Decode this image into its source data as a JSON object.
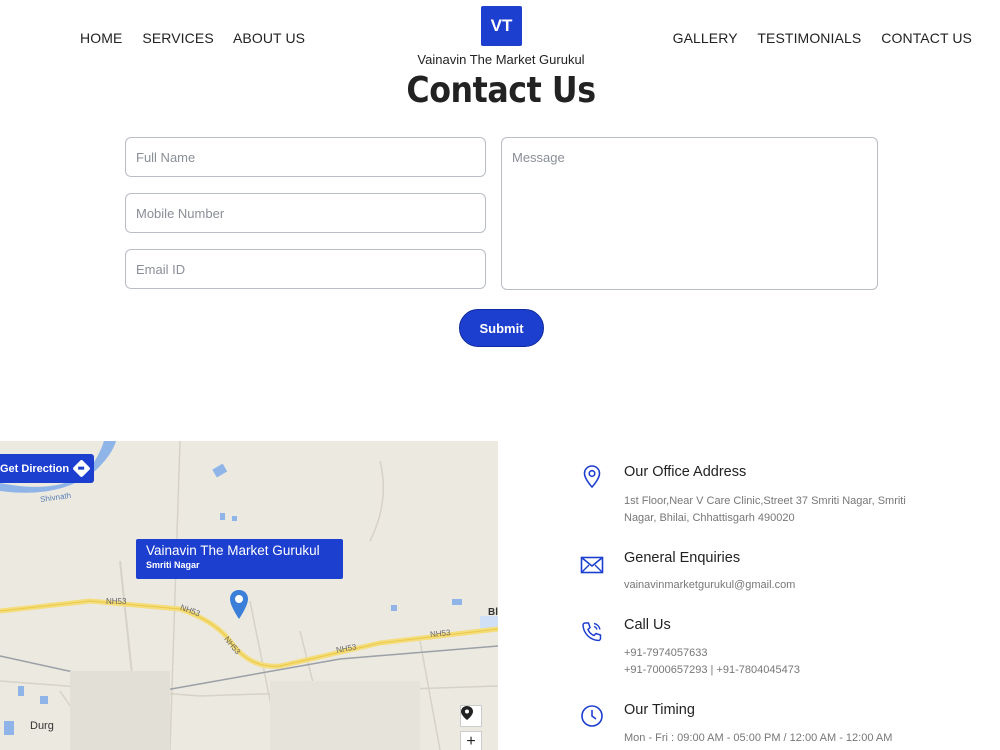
{
  "nav": {
    "left": [
      "HOME",
      "SERVICES",
      "ABOUT US"
    ],
    "right": [
      "GALLERY",
      "TESTIMONIALS",
      "CONTACT US"
    ]
  },
  "brand": {
    "logo": "VT",
    "name": "Vainavin The Market Gurukul"
  },
  "page_title": "Contact Us",
  "form": {
    "full_name": "Full Name",
    "mobile": "Mobile Number",
    "email": "Email ID",
    "message": "Message",
    "submit": "Submit"
  },
  "map": {
    "get_direction": "Get Direction",
    "place_name": "Vainavin The Market Gurukul",
    "place_sub": "Smriti Nagar",
    "city": "Durg",
    "road_labels": [
      "NH53",
      "NH53",
      "NH53",
      "NH53",
      "NH53"
    ],
    "river": "Shivnath",
    "edge_label": "Bl"
  },
  "contact": {
    "address": {
      "title": "Our Office Address",
      "lines": [
        "1st Floor,Near V Care Clinic,Street 37 Smriti Nagar, Smriti",
        "Nagar, Bhilai, Chhattisgarh 490020"
      ]
    },
    "enquiries": {
      "title": "General Enquiries",
      "email": "vainavinmarketgurukul@gmail.com"
    },
    "call": {
      "title": "Call Us",
      "lines": [
        "+91-7974057633",
        "+91-7000657293 | +91-7804045473"
      ]
    },
    "timing": {
      "title": "Our Timing",
      "line": "Mon - Fri : 09:00 AM - 05:00 PM / 12:00 AM - 12:00 AM"
    }
  },
  "colors": {
    "brand": "#1d3fd0"
  }
}
